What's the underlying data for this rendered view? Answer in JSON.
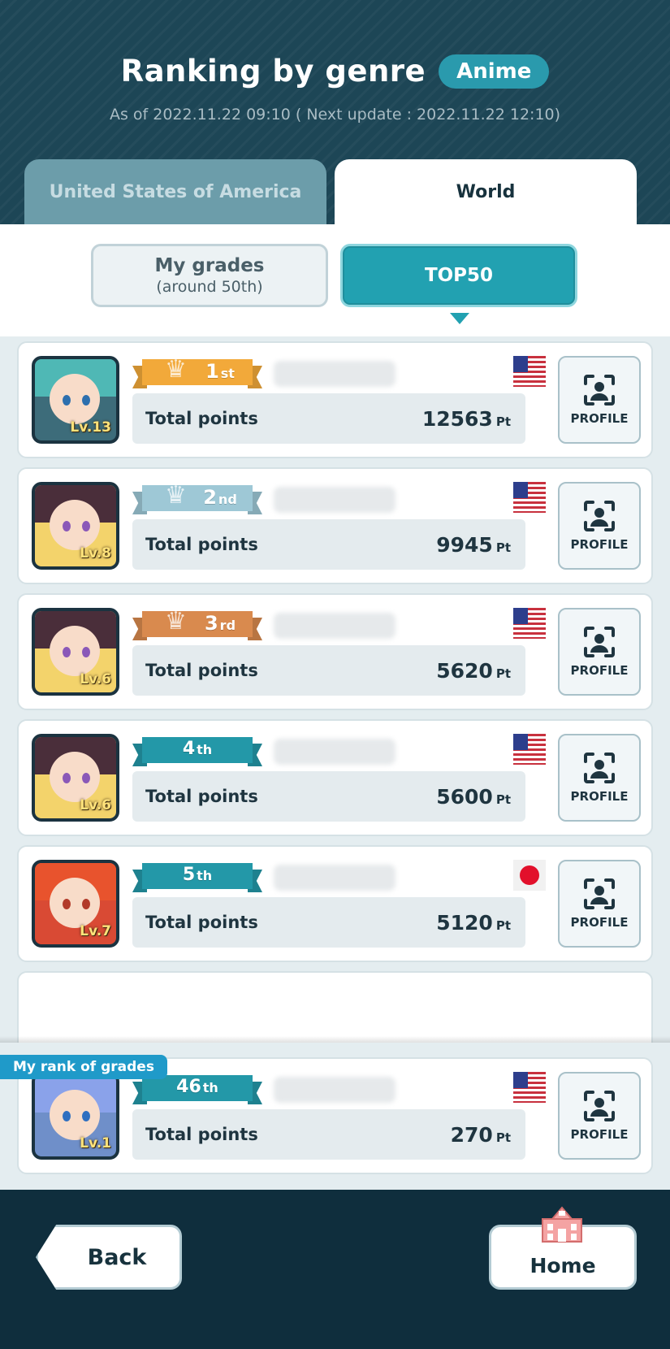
{
  "header": {
    "title": "Ranking by genre",
    "genre": "Anime",
    "as_of": "As of 2022.11.22 09:10 ( Next update : 2022.11.22 12:10)",
    "tabs": [
      {
        "label": "United States of America",
        "active": false
      },
      {
        "label": "World",
        "active": true
      }
    ]
  },
  "modes": {
    "my_grades_label": "My grades",
    "my_grades_sub": "(around 50th)",
    "top50_label": "TOP50",
    "selected": "TOP50"
  },
  "rows": [
    {
      "rank_num": "1",
      "rank_suffix": "st",
      "level": "Lv.13",
      "flag": "us",
      "points_label": "Total points",
      "points": "12563",
      "unit": "Pt",
      "profile_label": "PROFILE",
      "ribbon_color": "#f2a93a"
    },
    {
      "rank_num": "2",
      "rank_suffix": "nd",
      "level": "Lv.8",
      "flag": "us",
      "points_label": "Total points",
      "points": "9945",
      "unit": "Pt",
      "profile_label": "PROFILE",
      "ribbon_color": "#9ec8d6"
    },
    {
      "rank_num": "3",
      "rank_suffix": "rd",
      "level": "Lv.6",
      "flag": "us",
      "points_label": "Total points",
      "points": "5620",
      "unit": "Pt",
      "profile_label": "PROFILE",
      "ribbon_color": "#d98a4e"
    },
    {
      "rank_num": "4",
      "rank_suffix": "th",
      "level": "Lv.6",
      "flag": "us",
      "points_label": "Total points",
      "points": "5600",
      "unit": "Pt",
      "profile_label": "PROFILE",
      "ribbon_color": "#2398a8"
    },
    {
      "rank_num": "5",
      "rank_suffix": "th",
      "level": "Lv.7",
      "flag": "jp",
      "points_label": "Total points",
      "points": "5120",
      "unit": "Pt",
      "profile_label": "PROFILE",
      "ribbon_color": "#2398a8"
    }
  ],
  "my_rank": {
    "label": "My rank of grades",
    "rank_num": "46",
    "rank_suffix": "th",
    "level": "Lv.1",
    "flag": "us",
    "points_label": "Total points",
    "points": "270",
    "unit": "Pt",
    "profile_label": "PROFILE",
    "ribbon_color": "#2398a8"
  },
  "nav": {
    "back_label": "Back",
    "home_label": "Home"
  },
  "colors": {
    "header_bg": "#1d4656",
    "accent": "#22a1b1",
    "bottom_bar": "#0f2e3d",
    "my_rank_label_bg": "#1f9ac9"
  },
  "icons": {
    "medal": "crown-icon",
    "profile": "profile-scan-icon",
    "home": "home-building-icon",
    "back": "back-arrow-button"
  }
}
